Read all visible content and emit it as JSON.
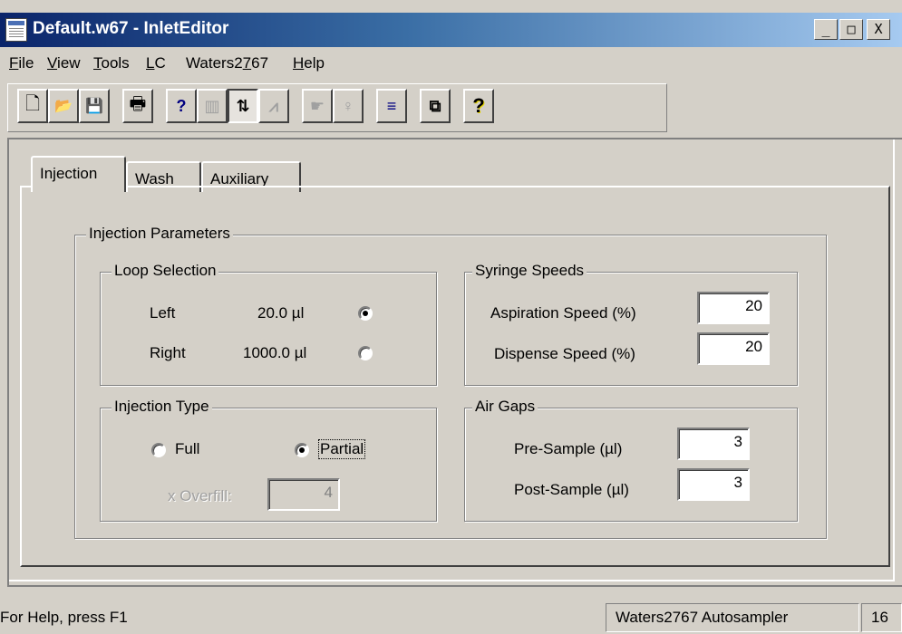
{
  "window": {
    "title": "Default.w67 - InletEditor",
    "controls": {
      "minimize": "_",
      "maximize": "□",
      "close": "X"
    }
  },
  "menu": [
    {
      "label": "File",
      "accel": "F",
      "rest": "ile"
    },
    {
      "label": "View",
      "accel": "V",
      "rest": "iew"
    },
    {
      "label": "Tools",
      "accel": "T",
      "rest": "ools"
    },
    {
      "label": "LC",
      "accel": "L",
      "rest": "C"
    },
    {
      "label": "Waters2767",
      "pre": "Waters2",
      "accel": "7",
      "post": "67"
    },
    {
      "label": "Help",
      "accel": "H",
      "rest": "elp"
    }
  ],
  "toolbar": {
    "buttons": [
      {
        "name": "new-icon",
        "glyph": "🗋"
      },
      {
        "name": "open-icon",
        "glyph": "📂"
      },
      {
        "name": "save-icon",
        "glyph": "💾"
      },
      {
        "name": "print-icon",
        "glyph": "🖶"
      },
      {
        "name": "context-help-icon",
        "glyph": "?"
      },
      {
        "name": "instrument-icon",
        "glyph": "▥"
      },
      {
        "name": "inlet-icon",
        "glyph": "⇅"
      },
      {
        "name": "chromatogram-icon",
        "glyph": "⩘"
      },
      {
        "name": "hand-icon",
        "glyph": "☛"
      },
      {
        "name": "bulb-icon",
        "glyph": "♀"
      },
      {
        "name": "list-icon",
        "glyph": "≡"
      },
      {
        "name": "stack-icon",
        "glyph": "⧉"
      },
      {
        "name": "help-icon",
        "glyph": "?"
      }
    ]
  },
  "tabs": [
    {
      "label": "Injection",
      "active": true
    },
    {
      "label": "Wash",
      "active": false
    },
    {
      "label": "Auxiliary",
      "active": false
    }
  ],
  "injection_parameters": {
    "title": "Injection Parameters",
    "loop_selection": {
      "title": "Loop Selection",
      "rows": [
        {
          "label": "Left",
          "volume": "20.0 µl",
          "selected": true
        },
        {
          "label": "Right",
          "volume": "1000.0 µl",
          "selected": false
        }
      ]
    },
    "injection_type": {
      "title": "Injection Type",
      "full_label": "Full",
      "partial_label": "Partial",
      "selected": "Partial",
      "overfill_label": "x Overfill:",
      "overfill_value": "4"
    },
    "syringe_speeds": {
      "title": "Syringe Speeds",
      "aspiration_label": "Aspiration Speed (%)",
      "aspiration_value": "20",
      "dispense_label": "Dispense Speed (%)",
      "dispense_value": "20"
    },
    "air_gaps": {
      "title": "Air Gaps",
      "pre_label": "Pre-Sample (µl)",
      "pre_value": "3",
      "post_label": "Post-Sample (µl)",
      "post_value": "3"
    }
  },
  "status_bar": {
    "help_text": "For Help, press F1",
    "instrument": "Waters2767 Autosampler",
    "extra": "16"
  }
}
